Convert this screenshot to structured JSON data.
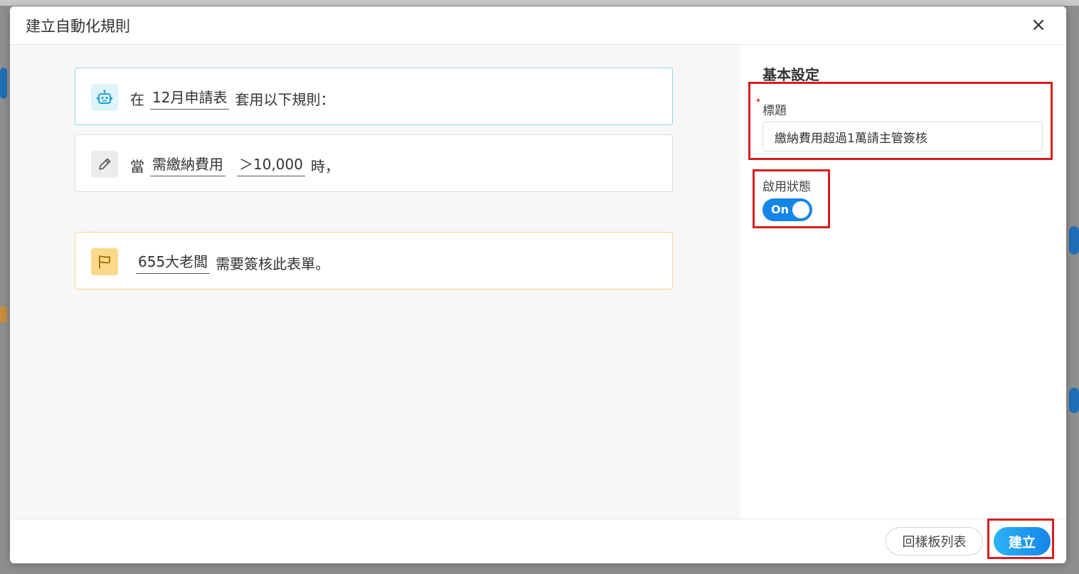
{
  "modal": {
    "title": "建立自動化規則"
  },
  "rule": {
    "trigger": {
      "prefix": "在",
      "form_name": "12月申請表",
      "suffix": "套用以下規則："
    },
    "condition": {
      "prefix": "當",
      "field": "需繳納費用",
      "operator_value": "＞10,000",
      "suffix": "時，"
    },
    "action": {
      "approver": "655大老闆",
      "suffix": "需要簽核此表單。"
    }
  },
  "settings": {
    "section_title": "基本設定",
    "title_label": "標題",
    "title_value": "繳納費用超過1萬請主管簽核",
    "status_label": "啟用狀態",
    "toggle_text": "On",
    "toggle_on": true
  },
  "footer": {
    "back_label": "回樣板列表",
    "create_label": "建立"
  },
  "colors": {
    "accent": "#1685e8",
    "highlight": "#d81e1e",
    "trigger_border": "#8ed5ea",
    "action_border": "#f6d58e"
  },
  "icons": {
    "trigger": "robot-icon",
    "condition": "pencil-icon",
    "action": "flag-icon",
    "add": "plus-icon",
    "close": "close-icon"
  }
}
